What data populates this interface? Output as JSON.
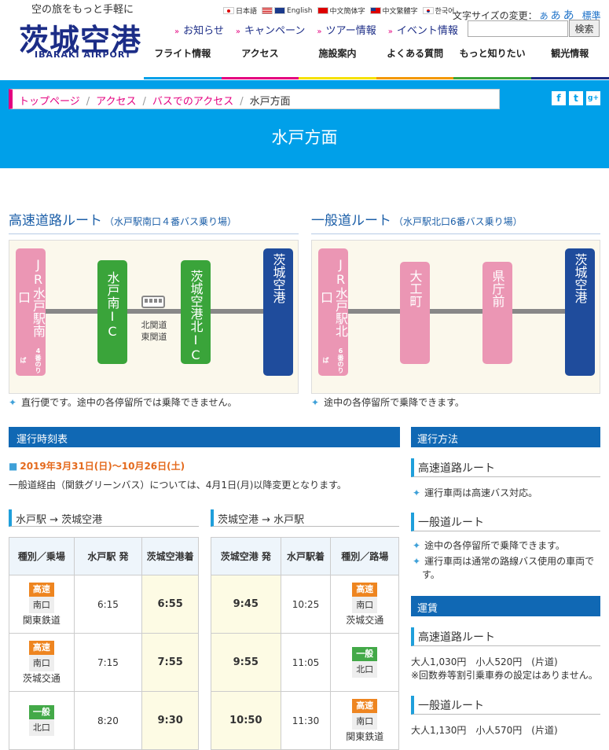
{
  "header": {
    "tagline": "空の旅をもっと手軽に",
    "logo": "茨城空港",
    "logo_en": "IBARAKI AIRPORT",
    "languages": [
      "日本語",
      "English",
      "中文簡体字",
      "中文繁體字",
      "한국어"
    ],
    "font_size_label": "文字サイズの変更：",
    "font_sizes": [
      "あ",
      "あ",
      "あ",
      "標準"
    ],
    "search_button": "検索",
    "top_nav": [
      "お知らせ",
      "キャンペーン",
      "ツアー情報",
      "イベント情報"
    ],
    "main_nav": [
      "フライト情報",
      "アクセス",
      "施設案内",
      "よくある質問",
      "もっと知りたい",
      "観光情報"
    ],
    "main_nav_colors": [
      "#00a0e9",
      "#e4007f",
      "#f5e100",
      "#f39800",
      "#3aa43a",
      "#1c2d87"
    ]
  },
  "breadcrumb": [
    "トップページ",
    "アクセス",
    "バスでのアクセス",
    "水戸方面"
  ],
  "social": [
    "f",
    "t",
    "g+"
  ],
  "page_title": "水戸方面",
  "routes": {
    "highway": {
      "title": "高速道路ルート",
      "sub": "（水戸駅南口４番バス乗り場）",
      "stops": [
        "JR水戸駅南口",
        "水戸南IC",
        "茨城空港北IC",
        "茨城空港"
      ],
      "stop_sub": "4番のりば",
      "road_label": "北関道東関道",
      "note": "直行便です。途中の各停留所では乗降できません。"
    },
    "general": {
      "title": "一般道ルート",
      "sub": "（水戸駅北口6番バス乗り場）",
      "stops": [
        "JR水戸駅北口",
        "大工町",
        "県庁前",
        "茨城空港"
      ],
      "stop_sub": "6番のりば",
      "note": "途中の各停留所で乗降できます。"
    }
  },
  "timetable": {
    "heading": "運行時刻表",
    "period": "2019年3月31日(日)～10月26日(土)",
    "notice": "一般道経由（関鉄グリーンバス）については、4月1日(月)以降変更となります。",
    "outbound": {
      "title": "水戸駅 → 茨城空港",
      "headers": [
        "種別／乗場",
        "水戸駅 発",
        "茨城空港着"
      ],
      "rows": [
        {
          "type": "高速",
          "platform": "南口",
          "company": "関東鉄道",
          "dep": "6:15",
          "arr": "6:55"
        },
        {
          "type": "高速",
          "platform": "南口",
          "company": "茨城交通",
          "dep": "7:15",
          "arr": "7:55"
        },
        {
          "type": "一般",
          "platform": "北口",
          "company": "",
          "dep": "8:20",
          "arr": "9:30"
        }
      ]
    },
    "inbound": {
      "title": "茨城空港 → 水戸駅",
      "headers": [
        "茨城空港 発",
        "水戸駅着",
        "種別／路場"
      ],
      "rows": [
        {
          "dep": "9:45",
          "arr": "10:25",
          "type": "高速",
          "platform": "南口",
          "company": "茨城交通"
        },
        {
          "dep": "9:55",
          "arr": "11:05",
          "type": "一般",
          "platform": "北口",
          "company": ""
        },
        {
          "dep": "10:50",
          "arr": "11:30",
          "type": "高速",
          "platform": "南口",
          "company": "関東鉄道"
        }
      ]
    }
  },
  "side": {
    "operation_heading": "運行方法",
    "highway_title": "高速道路ルート",
    "highway_notes": [
      "運行車両は高速バス対応。"
    ],
    "general_title": "一般道ルート",
    "general_notes": [
      "途中の各停留所で乗降できます。",
      "運行車両は通常の路線バス使用の車両です。"
    ],
    "fare_heading": "運賃",
    "fare_highway_title": "高速道路ルート",
    "fare_highway": "大人1,030円　小人520円　(片道)",
    "fare_highway_note": "※回数券等割引乗車券の設定はありません。",
    "fare_general_title": "一般道ルート",
    "fare_general": "大人1,130円　小人570円　(片道)"
  }
}
